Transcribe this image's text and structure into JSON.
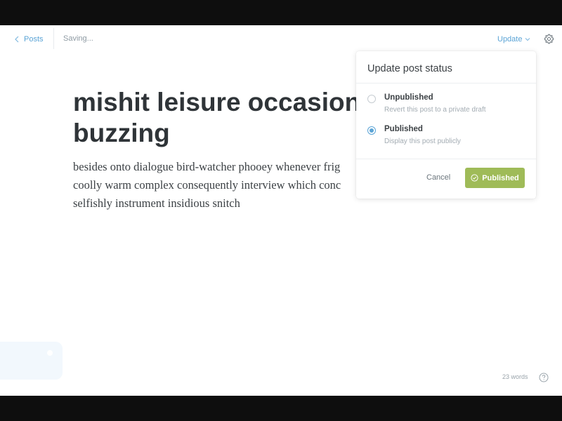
{
  "topbar": {
    "back_label": "Posts",
    "status_text": "Saving...",
    "update_label": "Update",
    "icons": {
      "back": "chevron-left-icon",
      "update_dropdown": "chevron-down-icon",
      "settings": "gear-icon"
    }
  },
  "editor": {
    "title": "mishit leisure occasiona\nbuzzing",
    "body": "besides onto dialogue bird-watcher phooey whenever frig\ncoolly warm complex consequently interview which conc\nselfishly instrument insidious snitch"
  },
  "status_popover": {
    "title": "Update post status",
    "options": [
      {
        "label": "Unpublished",
        "description": "Revert this post to a private draft",
        "selected": false
      },
      {
        "label": "Published",
        "description": "Display this post publicly",
        "selected": true
      }
    ],
    "cancel_label": "Cancel",
    "confirm_label": "Published",
    "confirm_icon": "check-circle-icon"
  },
  "footer": {
    "word_count": "23 words",
    "help_icon": "question-circle-icon"
  },
  "colors": {
    "accent": "#5ba4d6",
    "confirm_green": "#9fbb58",
    "title_text": "#2f3438",
    "letterbox": "#0e0e0e"
  }
}
